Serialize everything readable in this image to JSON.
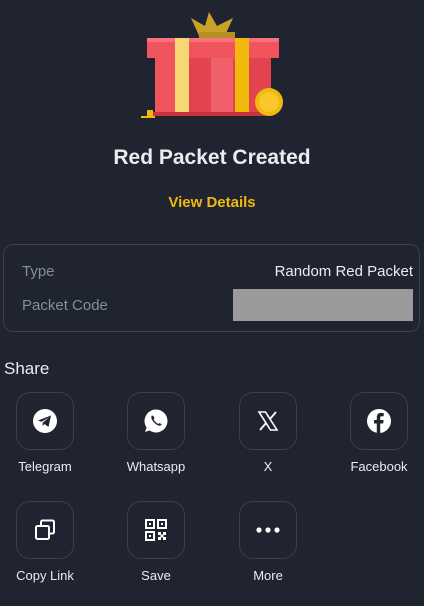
{
  "title": "Red Packet Created",
  "view_details": "View Details",
  "info": {
    "type_label": "Type",
    "type_value": "Random Red Packet",
    "code_label": "Packet Code"
  },
  "share": {
    "heading": "Share",
    "items": [
      {
        "label": "Telegram",
        "icon": "telegram-icon"
      },
      {
        "label": "Whatsapp",
        "icon": "whatsapp-icon"
      },
      {
        "label": "X",
        "icon": "x-icon"
      },
      {
        "label": "Facebook",
        "icon": "facebook-icon"
      },
      {
        "label": "Copy Link",
        "icon": "copy-icon"
      },
      {
        "label": "Save",
        "icon": "qr-code-icon"
      },
      {
        "label": "More",
        "icon": "more-icon"
      }
    ]
  },
  "colors": {
    "background": "#1f2430",
    "accent": "#f0b90b",
    "gift_red": "#f0545c",
    "gift_ribbon": "#f7d774"
  }
}
